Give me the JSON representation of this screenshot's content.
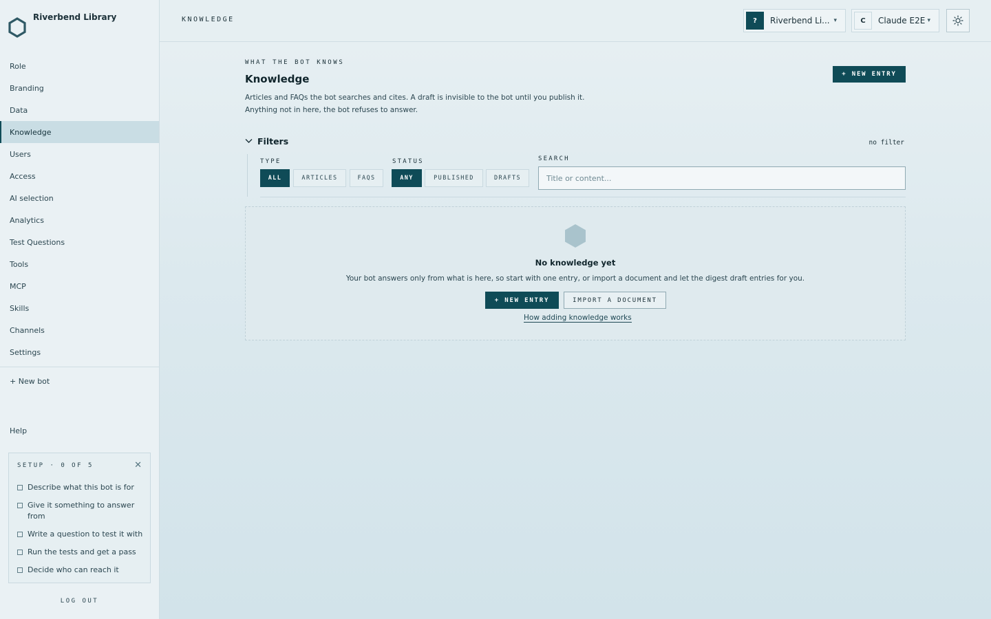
{
  "sidebar": {
    "brand": "Riverbend Library",
    "nav": [
      "Role",
      "Branding",
      "Data",
      "Knowledge",
      "Users",
      "Access",
      "AI selection",
      "Analytics",
      "Test Questions",
      "Tools",
      "MCP",
      "Skills",
      "Channels",
      "Settings"
    ],
    "active_item": "Knowledge",
    "new_bot": "+ New bot",
    "help": "Help",
    "setup": {
      "title": "SETUP · 0 OF 5",
      "items": [
        "Describe what this bot is for",
        "Give it something to answer from",
        "Write a question to test it with",
        "Run the tests and get a pass",
        "Decide who can reach it"
      ]
    },
    "logout": "LOG OUT"
  },
  "topbar": {
    "crumb": "KNOWLEDGE",
    "workspace": {
      "badge": "?",
      "label": "Riverbend Li..."
    },
    "model": {
      "badge": "C",
      "label": "Claude E2E"
    },
    "theme_icon": "sun-icon"
  },
  "main": {
    "eyebrow": "WHAT THE BOT KNOWS",
    "title": "Knowledge",
    "description_line1": "Articles and FAQs the bot searches and cites. A draft is invisible to the bot until you publish it.",
    "description_line2": "Anything not in here, the bot refuses to answer.",
    "new_entry": "+ NEW ENTRY",
    "filters": {
      "label": "Filters",
      "status_text": "no filter",
      "type_label": "TYPE",
      "type_options": [
        "ALL",
        "ARTICLES",
        "FAQS"
      ],
      "type_selected": "ALL",
      "status_label": "STATUS",
      "status_options": [
        "ANY",
        "PUBLISHED",
        "DRAFTS"
      ],
      "status_selected": "ANY",
      "search_label": "SEARCH",
      "search_placeholder": "Title or content...",
      "search_value": ""
    },
    "empty": {
      "title": "No knowledge yet",
      "text": "Your bot answers only from what is here, so start with one entry, or import a document and let the digest draft entries for you.",
      "new_entry": "+ NEW ENTRY",
      "import": "IMPORT A DOCUMENT",
      "link": "How adding knowledge works"
    }
  },
  "colors": {
    "accent": "#0f4b57",
    "background": "#e8f0f3",
    "active_nav": "#c9dde4"
  }
}
